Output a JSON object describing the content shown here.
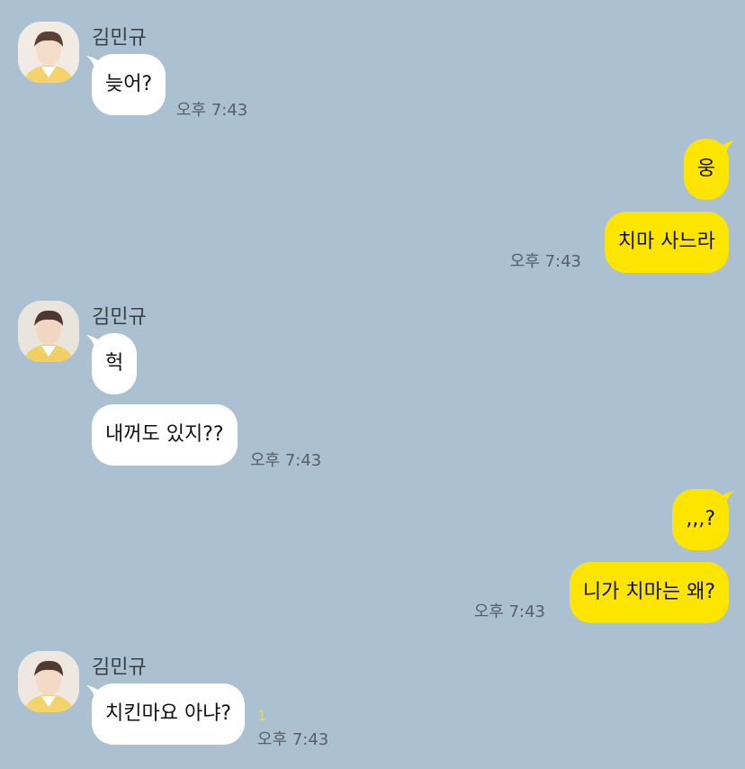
{
  "chat": {
    "background": "#abc1d1",
    "incoming_color": "#ffffff",
    "outgoing_color": "#fee500",
    "sender_name": "김민규",
    "groups": [
      {
        "sender": "김민규",
        "messages": [
          "늦어?"
        ],
        "time": "오후 7:43"
      },
      {
        "sender": "me",
        "messages": [
          "웅",
          "치마 사느라"
        ],
        "time": "오후 7:43"
      },
      {
        "sender": "김민규",
        "messages": [
          "헉",
          "내꺼도 있지??"
        ],
        "time": "오후 7:43"
      },
      {
        "sender": "me",
        "messages": [
          ",,,?",
          "니가 치마는 왜?"
        ],
        "time": "오후 7:43"
      },
      {
        "sender": "김민규",
        "messages": [
          "치킨마요 아냐?"
        ],
        "time": "오후 7:43",
        "unread_count": "1"
      }
    ]
  }
}
